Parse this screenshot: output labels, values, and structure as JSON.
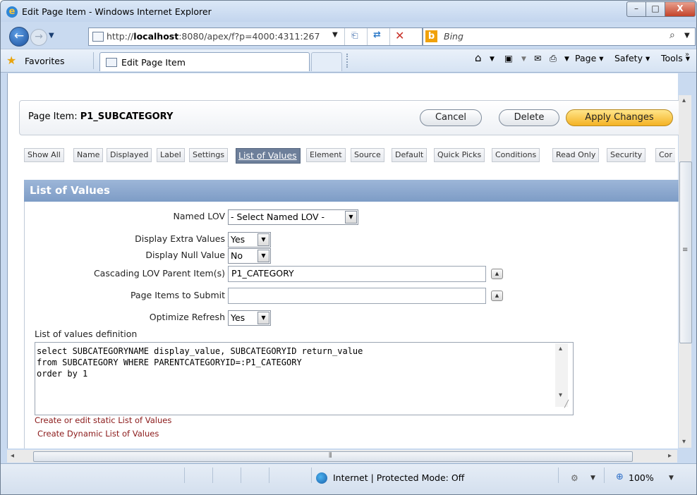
{
  "window": {
    "title": "Edit Page Item - Windows Internet Explorer",
    "minimize": "–",
    "maximize": "□",
    "close": "X"
  },
  "address_bar": {
    "url_prefix": "http://",
    "url_host": "localhost",
    "url_rest": ":8080/apex/f?p=4000:4311:267",
    "search_placeholder": "Bing"
  },
  "favorites_bar": {
    "favorites_label": "Favorites",
    "tab_title": "Edit Page Item",
    "commands": {
      "page": "Page ▾",
      "safety": "Safety ▾",
      "tools": "Tools ▾",
      "help": "?"
    }
  },
  "header": {
    "item_label": "Page Item:",
    "item_name": "P1_SUBCATEGORY",
    "cancel": "Cancel",
    "delete": "Delete",
    "apply": "Apply Changes"
  },
  "section_tabs": [
    "Show All",
    "Name",
    "Displayed",
    "Label",
    "Settings",
    "List of Values",
    "Element",
    "Source",
    "Default",
    "Quick Picks",
    "Conditions",
    "Read Only",
    "Security",
    "Cor"
  ],
  "selected_tab": "List of Values",
  "section": {
    "title": "List of Values"
  },
  "form": {
    "named_lov": {
      "label": "Named LOV",
      "value": "- Select Named LOV -"
    },
    "display_extra": {
      "label": "Display Extra Values",
      "value": "Yes"
    },
    "display_null": {
      "label": "Display Null Value",
      "value": "No"
    },
    "cascading_parent": {
      "label": "Cascading LOV Parent Item(s)",
      "value": "P1_CATEGORY"
    },
    "page_items_submit": {
      "label": "Page Items to Submit",
      "value": ""
    },
    "optimize_refresh": {
      "label": "Optimize Refresh",
      "value": "Yes"
    },
    "lov_definition": {
      "label": "List of values definition",
      "value": "select SUBCATEGORYNAME display_value, SUBCATEGORYID return_value\nfrom SUBCATEGORY WHERE PARENTCATEGORYID=:P1_CATEGORY\norder by 1"
    },
    "link_static": "Create or edit static List of Values",
    "link_dynamic": "Create Dynamic List of Values"
  },
  "status_bar": {
    "zone": "Internet | Protected Mode: Off",
    "zoom": "100%"
  }
}
